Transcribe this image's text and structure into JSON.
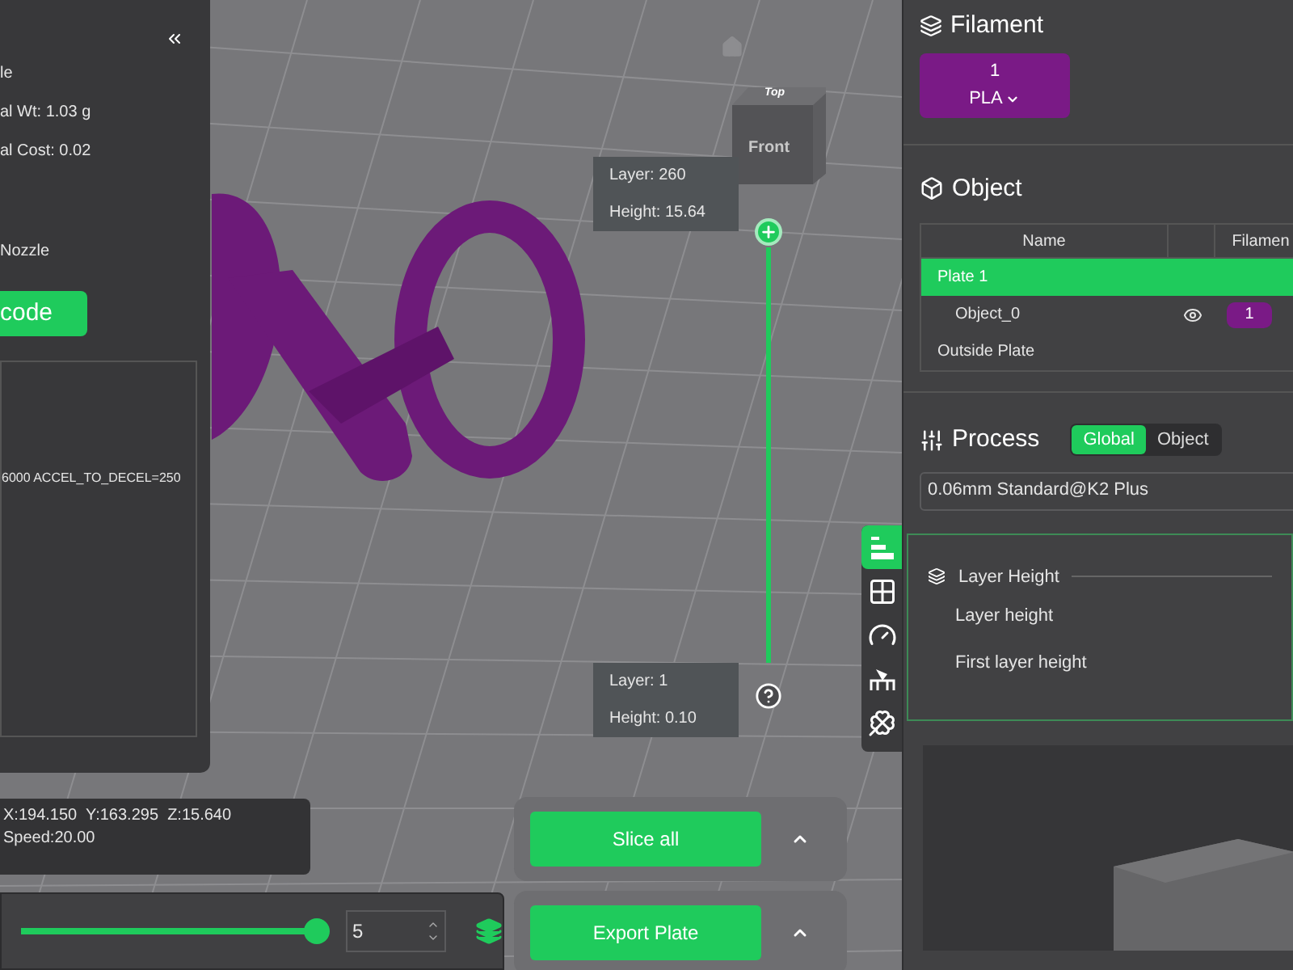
{
  "left_panel": {
    "lines": [
      "le",
      "al Wt: 1.03 g",
      "al Cost: 0.02"
    ],
    "nozzle_label": "Nozzle",
    "gcode_button": "code",
    "log_lines": [
      "6000 ACCEL_TO_DECEL=250"
    ]
  },
  "viewcube": {
    "top": "Top",
    "front": "Front"
  },
  "layer_slider": {
    "top": {
      "layer": "Layer: 260",
      "height": "Height: 15.64"
    },
    "bottom": {
      "layer": "Layer: 1",
      "height": "Height: 0.10"
    }
  },
  "position_readout": [
    "X:194.150  Y:163.295  Z:15.640",
    "Speed:20.00"
  ],
  "move_slider": {
    "level": 1,
    "value": "5"
  },
  "actions": [
    "Slice all",
    "Export Plate"
  ],
  "filament": {
    "title": "Filament",
    "slots": [
      {
        "number": "1",
        "type": "PLA",
        "color": "#7a1a86"
      }
    ]
  },
  "object": {
    "title": "Object",
    "columns": [
      "Name",
      "Filamen"
    ],
    "rows": [
      {
        "name": "Plate 1",
        "selected": true,
        "children": [
          {
            "name": "Object_0",
            "visible": true,
            "filament": "1",
            "selected": false
          }
        ]
      },
      {
        "name": "Outside Plate",
        "selected": false,
        "children": []
      }
    ]
  },
  "process": {
    "title": "Process",
    "tabs": [
      {
        "label": "Global",
        "selected": true
      },
      {
        "label": "Object",
        "selected": false
      }
    ],
    "preset": "0.06mm Standard@K2 Plus"
  },
  "side_tabs": [
    {
      "kind": "quality",
      "selected": true
    },
    {
      "kind": "strength",
      "selected": false
    },
    {
      "kind": "speed",
      "selected": false
    },
    {
      "kind": "support",
      "selected": false
    },
    {
      "kind": "others",
      "selected": false
    }
  ],
  "settings": {
    "group": "Layer Height",
    "items": [
      "Layer height",
      "First layer height"
    ]
  }
}
